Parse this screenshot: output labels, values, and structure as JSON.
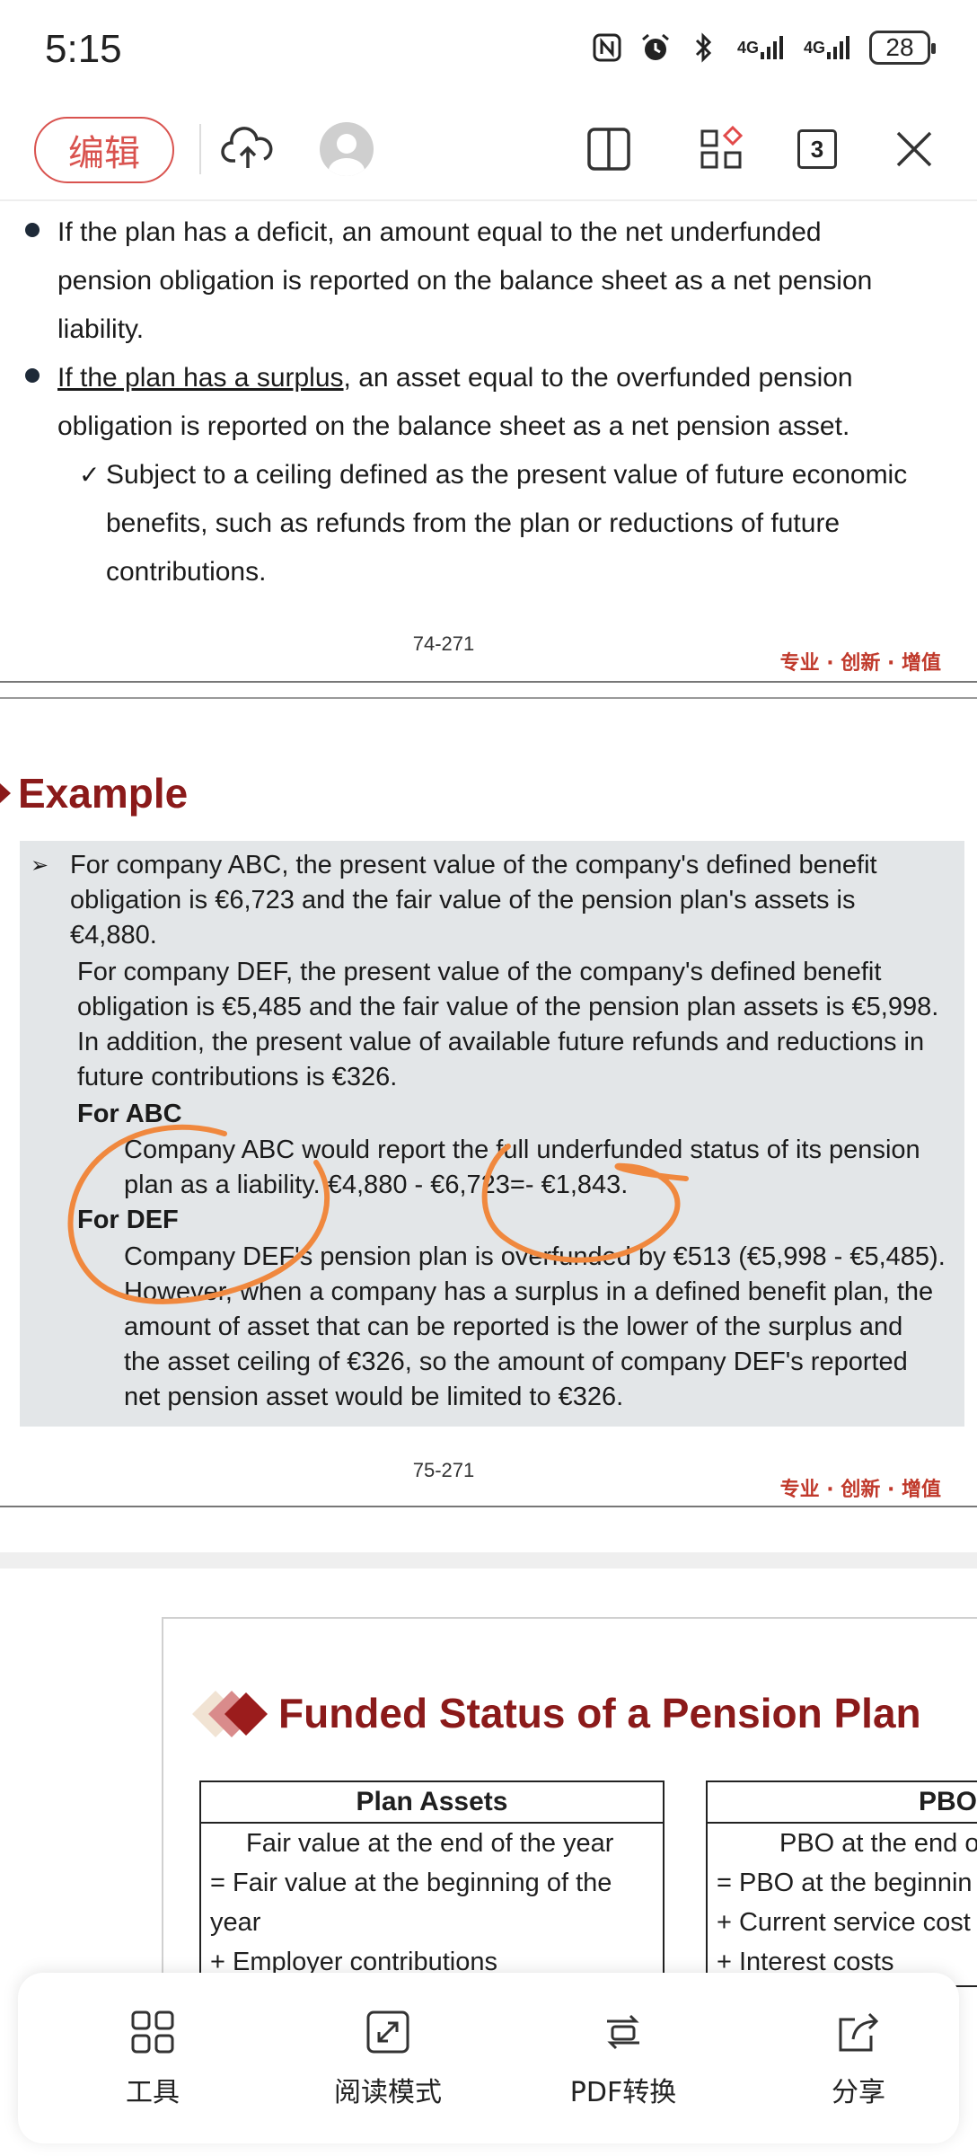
{
  "status_bar": {
    "time": "5:15",
    "network_1": "4G",
    "network_2": "4G",
    "battery": "28"
  },
  "toolbar": {
    "edit_label": "编辑",
    "tab_count": "3"
  },
  "page1": {
    "bullet1_lines": [
      "If the plan has a deficit, an amount equal to the net underfunded",
      "pension obligation is reported on the balance sheet as a net pension",
      "liability."
    ],
    "bullet2_underlined": "If the plan has a surplus",
    "bullet2_rest": ", an asset equal to the overfunded pension",
    "bullet2_line2": "obligation is reported on the balance sheet as a net pension asset.",
    "sub_lines": [
      "Subject to a ceiling defined as the present value of future economic",
      "benefits, such as refunds from the plan or reductions of future",
      "contributions."
    ],
    "page_number": "74-271",
    "brand": "专业 · 创新 · 增值"
  },
  "page2": {
    "title": "Example",
    "lines": [
      "For company ABC, the present value of the company's defined benefit",
      "obligation is €6,723 and the fair value of the pension plan's assets is",
      "€4,880.",
      "For company DEF, the present value of the company's defined benefit",
      "obligation is €5,485 and the fair value of the pension plan assets is €5,998.",
      "In addition, the present value of available future refunds and reductions in",
      "future contributions is €326.",
      "For ABC",
      "Company ABC would report the full underfunded status of its pension",
      "plan as a liability. €4,880 - €6,723=- €1,843.",
      "For DEF",
      "Company DEF's pension plan is overfunded by €513 (€5,998 - €5,485).",
      "However, when a company has a surplus in a defined benefit plan, the",
      "amount of asset that can be reported is the lower of the surplus and",
      "the asset ceiling of €326, so the amount of company DEF's reported",
      "net pension asset would be limited to €326."
    ],
    "page_number": "75-271",
    "brand": "专业 · 创新 · 增值"
  },
  "page3": {
    "title": "Funded Status of a Pension Plan",
    "plan_assets_header": "Plan Assets",
    "plan_assets_rows": [
      "Fair value at the end of the year",
      "= Fair value at the beginning of the",
      "year",
      "+ Employer contributions"
    ],
    "pbo_header": "PBO",
    "pbo_rows": [
      "PBO at the end o",
      "= PBO at the beginnin",
      "+ Current service cost",
      "+ Interest costs"
    ]
  },
  "bottom_bar": {
    "tools": "工具",
    "reading_mode": "阅读模式",
    "pdf_convert": "PDF转换",
    "share": "分享"
  },
  "colors": {
    "accent_red": "#8b1a1a",
    "edit_red": "#d9534f",
    "annotation_orange": "#f0883e",
    "example_box": "#e3e6e8"
  }
}
